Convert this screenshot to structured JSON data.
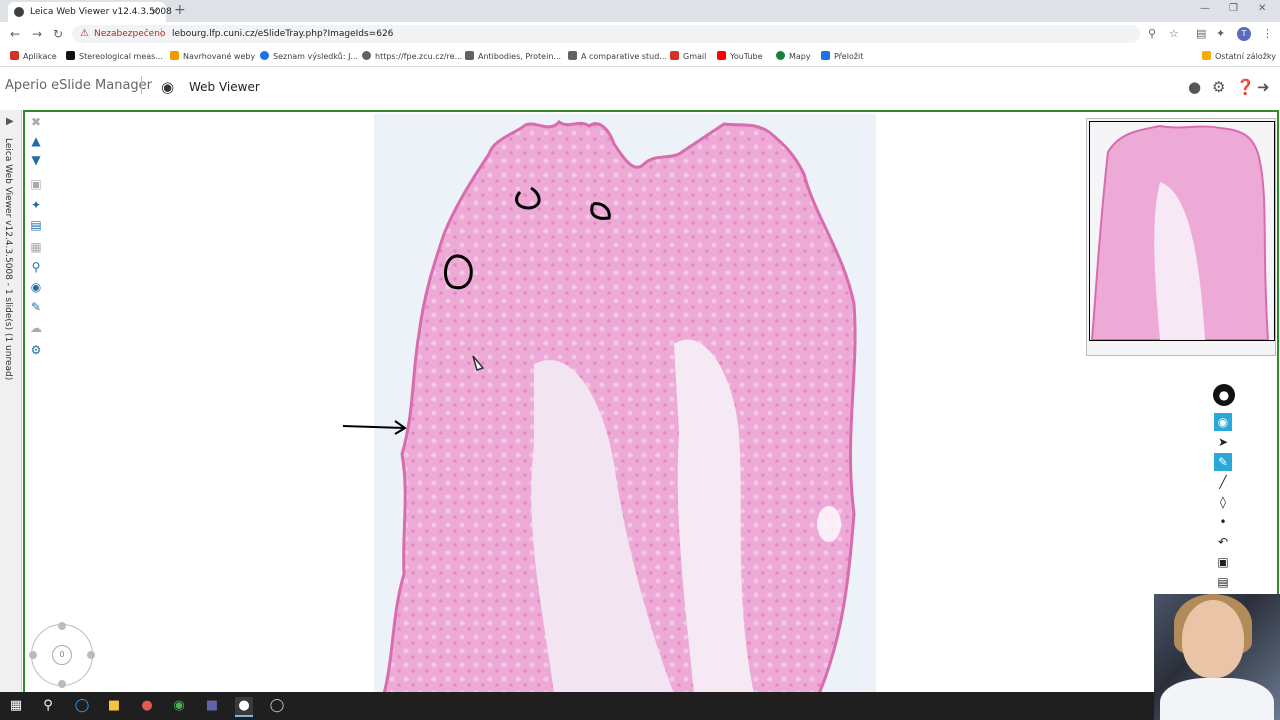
{
  "browser": {
    "tab_title": "Leica Web Viewer v12.4.3.5008",
    "tab_close": "×",
    "new_tab": "+",
    "security_label": "Nezabezpečeno",
    "url": "lebourg.lfp.cuni.cz/eSlideTray.php?ImageIds=626",
    "profile_initial": "T",
    "bookmarks": [
      {
        "label": "Aplikace",
        "color": "#d93025"
      },
      {
        "label": "Stereological meas...",
        "color": "#111111"
      },
      {
        "label": "Navrhované weby",
        "color": "#f29900"
      },
      {
        "label": "Seznam výsledků: J...",
        "color": "#1a73e8"
      },
      {
        "label": "https://fpe.zcu.cz/re...",
        "color": "#5f6368"
      },
      {
        "label": "Antibodies, Protein...",
        "color": "#5f6368"
      },
      {
        "label": "A comparative stud...",
        "color": "#5f6368"
      },
      {
        "label": "Gmail",
        "color": "#d93025"
      },
      {
        "label": "YouTube",
        "color": "#ff0000"
      },
      {
        "label": "Mapy",
        "color": "#188038"
      },
      {
        "label": "Přeložit",
        "color": "#1a73e8"
      }
    ],
    "other_bookmarks": "Ostatní záložky"
  },
  "app": {
    "brand": "Aperio eSlide Manager",
    "view_label": "Web Viewer"
  },
  "viewer": {
    "side_label": "Leica Web Viewer v12.4.3.5008 - 1 slide(s) (1 unread)",
    "compass_center": "0"
  },
  "colors": {
    "frame_border": "#2e8b2e",
    "tissue": "#e98fc8",
    "tool_active": "#2aa8d8",
    "tool_icon": "#1e6fa8"
  }
}
